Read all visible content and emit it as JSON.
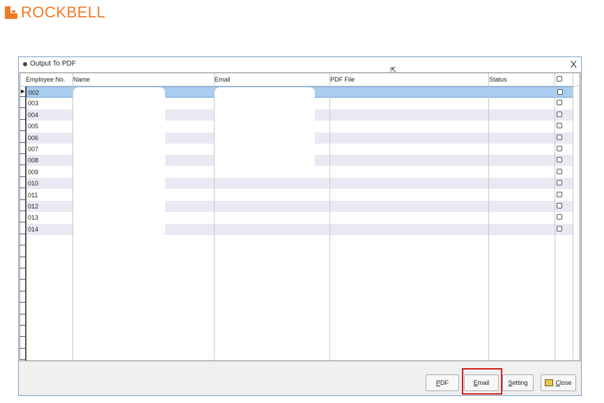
{
  "logo": {
    "text": "ROCKBELL",
    "color": "#f07a25"
  },
  "window": {
    "title": "Output To PDF",
    "close_glyph": "X"
  },
  "grid": {
    "columns": [
      "Employee No.",
      "Name",
      "Email",
      "PDF File",
      "Status"
    ],
    "rows": [
      {
        "emp": "002",
        "checked": false,
        "selected": true
      },
      {
        "emp": "003",
        "checked": false
      },
      {
        "emp": "004",
        "checked": false
      },
      {
        "emp": "005",
        "checked": false
      },
      {
        "emp": "006",
        "checked": false
      },
      {
        "emp": "007",
        "checked": false
      },
      {
        "emp": "008",
        "checked": false
      },
      {
        "emp": "009",
        "checked": false
      },
      {
        "emp": "010",
        "checked": false
      },
      {
        "emp": "011",
        "checked": false
      },
      {
        "emp": "012",
        "checked": false
      },
      {
        "emp": "013",
        "checked": false
      },
      {
        "emp": "014",
        "checked": false
      }
    ]
  },
  "buttons": {
    "pdf": {
      "first": "P",
      "rest": "DF"
    },
    "email": {
      "first": "E",
      "rest": "mail"
    },
    "setting": {
      "first": "S",
      "rest": "etting"
    },
    "close": {
      "first": "C",
      "rest": "lose"
    }
  },
  "colors": {
    "selected_row": "#a9cdef",
    "alt_row": "#e9e9f3",
    "highlight_box": "#cc1f1f"
  }
}
